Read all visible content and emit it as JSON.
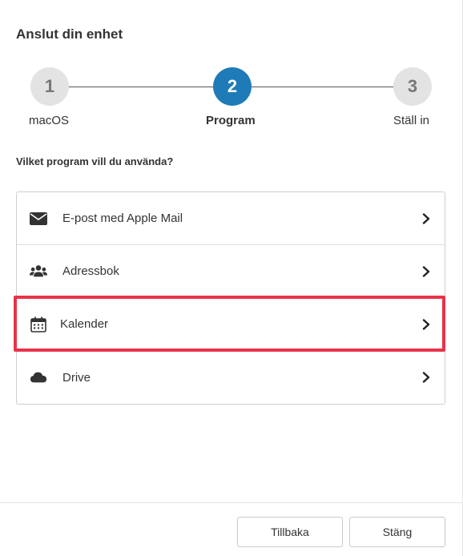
{
  "dialog": {
    "title": "Anslut din enhet"
  },
  "stepper": {
    "steps": [
      {
        "number": "1",
        "label": "macOS",
        "state": "inactive"
      },
      {
        "number": "2",
        "label": "Program",
        "state": "active"
      },
      {
        "number": "3",
        "label": "Ställ in",
        "state": "inactive"
      }
    ],
    "active_color": "#1f7bb8"
  },
  "question": "Vilket program vill du använda?",
  "apps": [
    {
      "label": "E-post med Apple Mail",
      "icon": "envelope-icon"
    },
    {
      "label": "Adressbok",
      "icon": "users-icon"
    },
    {
      "label": "Kalender",
      "icon": "calendar-icon",
      "highlighted": true
    },
    {
      "label": "Drive",
      "icon": "cloud-icon"
    }
  ],
  "highlight_color": "#e8334a",
  "footer": {
    "back_label": "Tillbaka",
    "close_label": "Stäng"
  }
}
